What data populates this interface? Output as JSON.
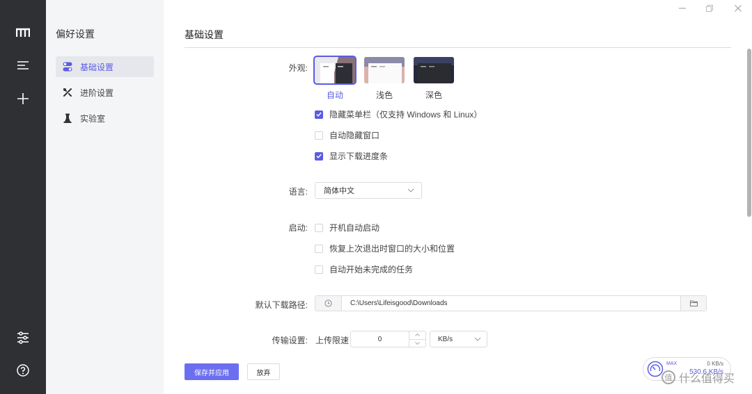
{
  "window": {
    "minimize_icon": "minimize-icon",
    "restore_icon": "restore-icon",
    "close_icon": "close-icon"
  },
  "rail": {
    "items": [
      "logo-icon",
      "menu-icon",
      "plus-icon",
      "sliders-icon",
      "help-icon"
    ]
  },
  "sidebar": {
    "title": "偏好设置",
    "items": [
      {
        "label": "基础设置",
        "icon": "toggle-icon",
        "active": true
      },
      {
        "label": "进阶设置",
        "icon": "tools-icon",
        "active": false
      },
      {
        "label": "实验室",
        "icon": "flask-icon",
        "active": false
      }
    ]
  },
  "main": {
    "title": "基础设置",
    "appearance": {
      "label": "外观:",
      "themes": [
        {
          "label": "自动",
          "selected": true
        },
        {
          "label": "浅色",
          "selected": false
        },
        {
          "label": "深色",
          "selected": false
        }
      ],
      "options": [
        {
          "label": "隐藏菜单栏（仅支持 Windows 和 Linux）",
          "checked": true
        },
        {
          "label": "自动隐藏窗口",
          "checked": false
        },
        {
          "label": "显示下载进度条",
          "checked": true
        }
      ]
    },
    "language": {
      "label": "语言:",
      "value": "简体中文"
    },
    "startup": {
      "label": "启动:",
      "options": [
        {
          "label": "开机自动启动",
          "checked": false
        },
        {
          "label": "恢复上次退出时窗口的大小和位置",
          "checked": false
        },
        {
          "label": "自动开始未完成的任务",
          "checked": false
        }
      ]
    },
    "download_path": {
      "label": "默认下载路径:",
      "value": "C:\\Users\\Lifeisgood\\Downloads"
    },
    "transfer": {
      "label": "传输设置:",
      "upload_label": "上传限速",
      "upload_value": "0",
      "unit": "KB/s"
    },
    "buttons": {
      "save": "保存并应用",
      "discard": "放弃"
    }
  },
  "speed_widget": {
    "max_label": "MAX",
    "upload": "0 KB/s",
    "download": "530.6 KB/s"
  },
  "watermark": {
    "text": "什么值得买",
    "badge": "值"
  },
  "colors": {
    "accent": "#5b5ce2",
    "rail": "#2f3033",
    "sidebar": "#f4f5f7"
  }
}
